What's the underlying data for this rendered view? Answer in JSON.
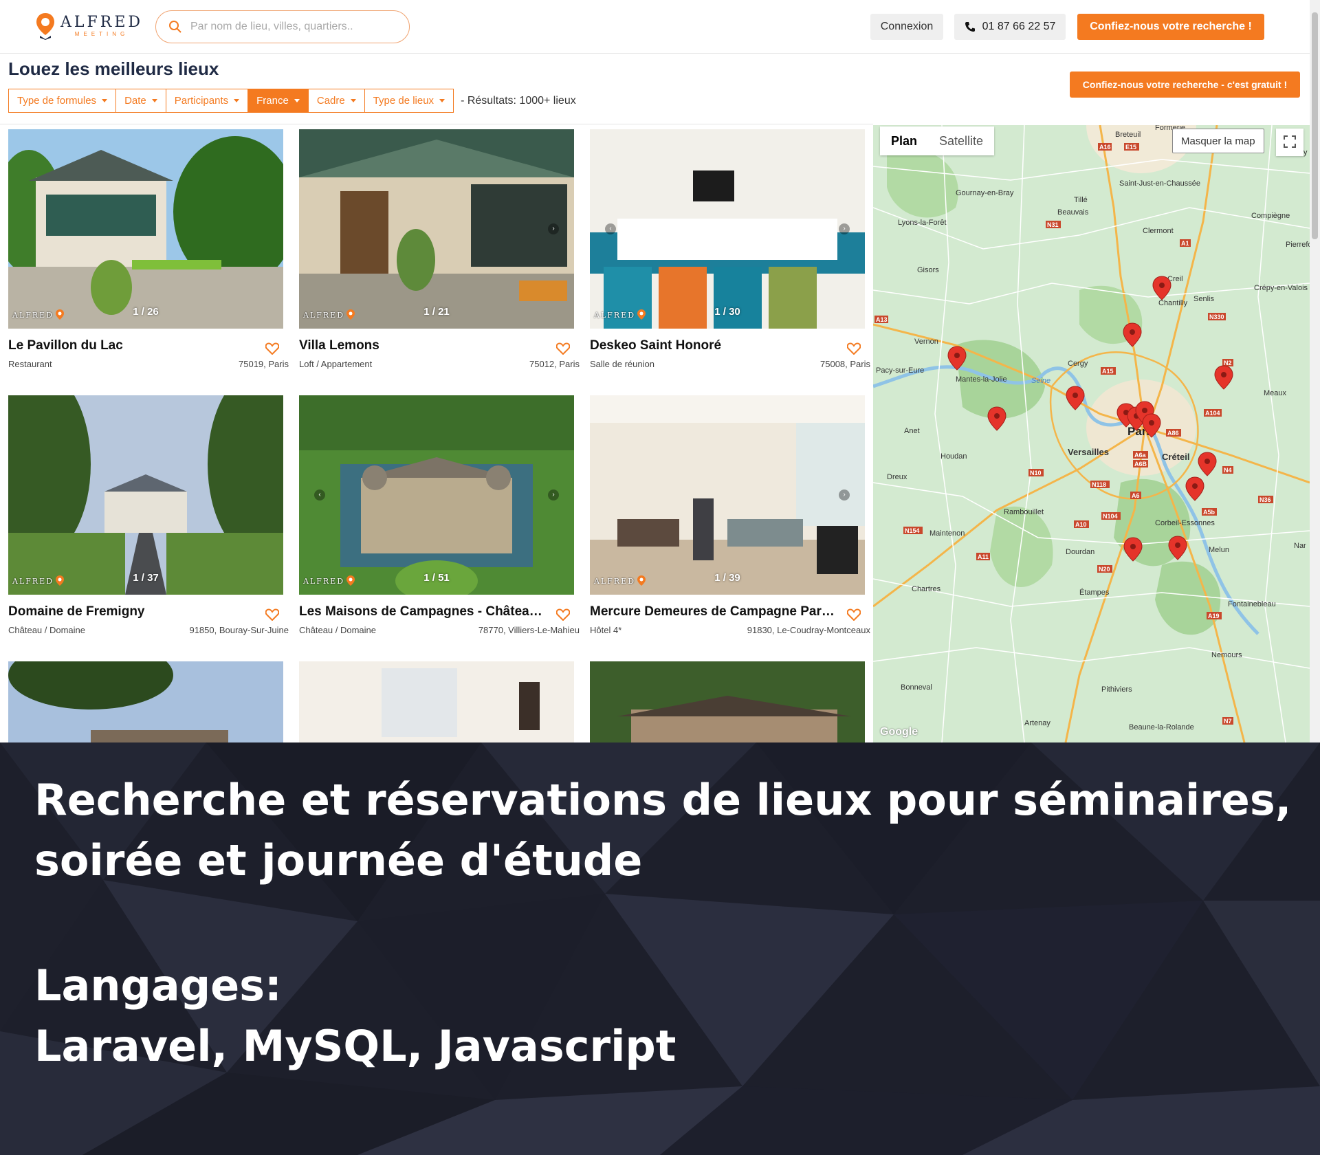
{
  "header": {
    "logo_word": "ALFRED",
    "logo_sub": "MEETING",
    "search_placeholder": "Par nom de lieu, villes, quartiers..",
    "connexion": "Connexion",
    "phone": "01 87 66 22 57",
    "cta": "Confiez-nous votre recherche !"
  },
  "page": {
    "title": "Louez les meilleurs lieux",
    "results": "- Résultats: 1000+ lieux",
    "cta": "Confiez-nous votre recherche - c'est gratuit !"
  },
  "filters": [
    {
      "label": "Type de formules",
      "active": false
    },
    {
      "label": "Date",
      "active": false
    },
    {
      "label": "Participants",
      "active": false
    },
    {
      "label": "France",
      "active": true
    },
    {
      "label": "Cadre",
      "active": false
    },
    {
      "label": "Type de lieux",
      "active": false
    }
  ],
  "cards": [
    {
      "title": "Le Pavillon du Lac",
      "type": "Restaurant",
      "location": "75019, Paris",
      "counter": "1 / 26"
    },
    {
      "title": "Villa Lemons",
      "type": "Loft / Appartement",
      "location": "75012, Paris",
      "counter": "1 / 21"
    },
    {
      "title": "Deskeo Saint Honoré",
      "type": "Salle de réunion",
      "location": "75008, Paris",
      "counter": "1 / 30"
    },
    {
      "title": "Domaine de Fremigny",
      "type": "Château / Domaine",
      "location": "91850, Bouray-Sur-Juine",
      "counter": "1 / 37"
    },
    {
      "title": "Les Maisons de Campagnes - Château de Villiers-le-Mahieu",
      "type": "Château / Domaine",
      "location": "78770, Villiers-Le-Mahieu",
      "counter": "1 / 51"
    },
    {
      "title": "Mercure Demeures de Campagne Paris Ouest",
      "type": "Hôtel 4*",
      "location": "91830, Le-Coudray-Montceaux",
      "counter": "1 / 39"
    }
  ],
  "map": {
    "plan": "Plan",
    "satellite": "Satellite",
    "hide": "Masquer la map",
    "google": "Google",
    "places": [
      {
        "name": "Breteuil"
      },
      {
        "name": "Formerie"
      },
      {
        "name": "Saint-Just-en-Chaussée"
      },
      {
        "name": "Gournay-en-Bray"
      },
      {
        "name": "Tillé"
      },
      {
        "name": "Beauvais"
      },
      {
        "name": "Lyons-la-Forêt"
      },
      {
        "name": "Compiègne"
      },
      {
        "name": "Clermont"
      },
      {
        "name": "Pierrefo"
      },
      {
        "name": "Gisors"
      },
      {
        "name": "Creil"
      },
      {
        "name": "Chantilly"
      },
      {
        "name": "Senlis"
      },
      {
        "name": "Crépy-en-Valois"
      },
      {
        "name": "Vernon"
      },
      {
        "name": "Cergy"
      },
      {
        "name": "Pacy-sur-Eure"
      },
      {
        "name": "Mantes-la-Jolie"
      },
      {
        "name": "Meaux"
      },
      {
        "name": "Anet"
      },
      {
        "name": "Paris"
      },
      {
        "name": "Versailles"
      },
      {
        "name": "Créteil"
      },
      {
        "name": "Houdan"
      },
      {
        "name": "Dreux"
      },
      {
        "name": "Rambouillet"
      },
      {
        "name": "Corbeil-Essonnes"
      },
      {
        "name": "Maintenon"
      },
      {
        "name": "Dourdan"
      },
      {
        "name": "Melun"
      },
      {
        "name": "Chartres"
      },
      {
        "name": "Étampes"
      },
      {
        "name": "Fontainebleau"
      },
      {
        "name": "Nemours"
      },
      {
        "name": "Bonneval"
      },
      {
        "name": "Pithiviers"
      },
      {
        "name": "Artenay"
      },
      {
        "name": "Beaune-la-Rolande"
      },
      {
        "name": "Nar"
      },
      {
        "name": "Noy"
      },
      {
        "name": "Seine"
      }
    ],
    "roads": [
      "A16",
      "N31",
      "A1",
      "N330",
      "A13",
      "A15",
      "A104",
      "A86",
      "A6a",
      "A6B",
      "N10",
      "N118",
      "A6",
      "N104",
      "N154",
      "A10",
      "A11",
      "N20",
      "A5b",
      "N36",
      "A19",
      "N7",
      "N2",
      "N4",
      "E15"
    ]
  },
  "banner": {
    "line1": "Recherche et réservations de lieux pour séminaires,",
    "line2": "soirée et journée d'étude",
    "line3": "Langages:",
    "line4": "Laravel, MySQL, Javascript"
  },
  "colors": {
    "accent": "#f47a20",
    "navy": "#1f2a44",
    "banner_bg": "#1d1f2b"
  }
}
